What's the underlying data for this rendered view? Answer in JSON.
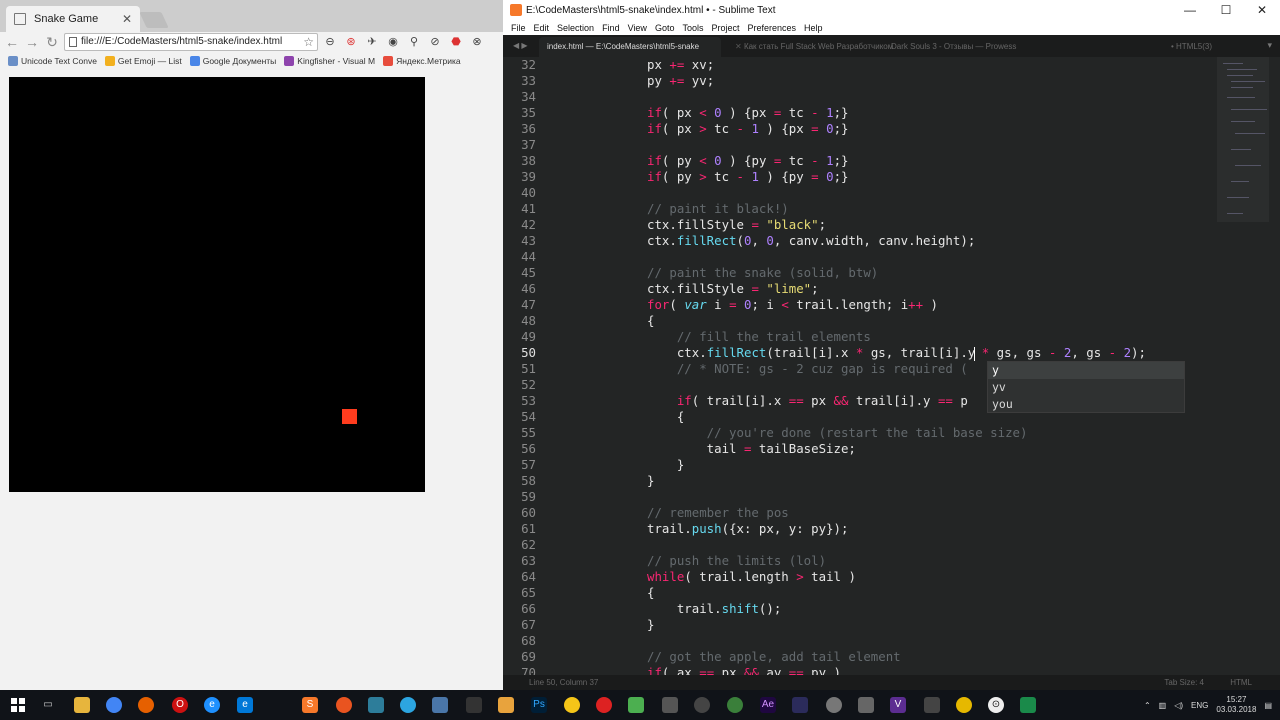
{
  "chrome": {
    "tab_title": "Snake Game",
    "tab_close": "✕",
    "url": "file:///E:/CodeMasters/html5-snake/index.html",
    "nav": {
      "back": "←",
      "forward": "→",
      "reload": "↻"
    },
    "bookmarks": [
      {
        "label": "Unicode Text Conve",
        "color": "#6a8fc7"
      },
      {
        "label": "Get Emoji — List",
        "color": "#f2b01e"
      },
      {
        "label": "Google Документы",
        "color": "#4a86e8"
      },
      {
        "label": "Kingfisher - Visual M",
        "color": "#8e44ad"
      },
      {
        "label": "Яндекс.Метрика",
        "color": "#e74c3c"
      }
    ]
  },
  "sublime": {
    "title": "E:\\CodeMasters\\html5-snake\\index.html • - Sublime Text",
    "menu": [
      "File",
      "Edit",
      "Selection",
      "Find",
      "View",
      "Goto",
      "Tools",
      "Project",
      "Preferences",
      "Help"
    ],
    "tabs": [
      {
        "label": "index.html — E:\\CodeMasters\\html5-snake",
        "active": true
      },
      {
        "label": "Как стать Full Stack Web Разработчиком",
        "active": false
      },
      {
        "label": "Dark Souls 3 - Отзывы — Prowess",
        "active": false
      },
      {
        "label": "• HTML5(3)",
        "active": false
      }
    ],
    "status_left": "Line 50, Column 37",
    "status_tab": "Tab Size: 4",
    "status_syntax": "HTML",
    "autocomplete": [
      "y",
      "yv",
      "you"
    ]
  },
  "taskbar": {
    "lang": "ENG",
    "time": "15:27",
    "date": "03.03.2018"
  }
}
